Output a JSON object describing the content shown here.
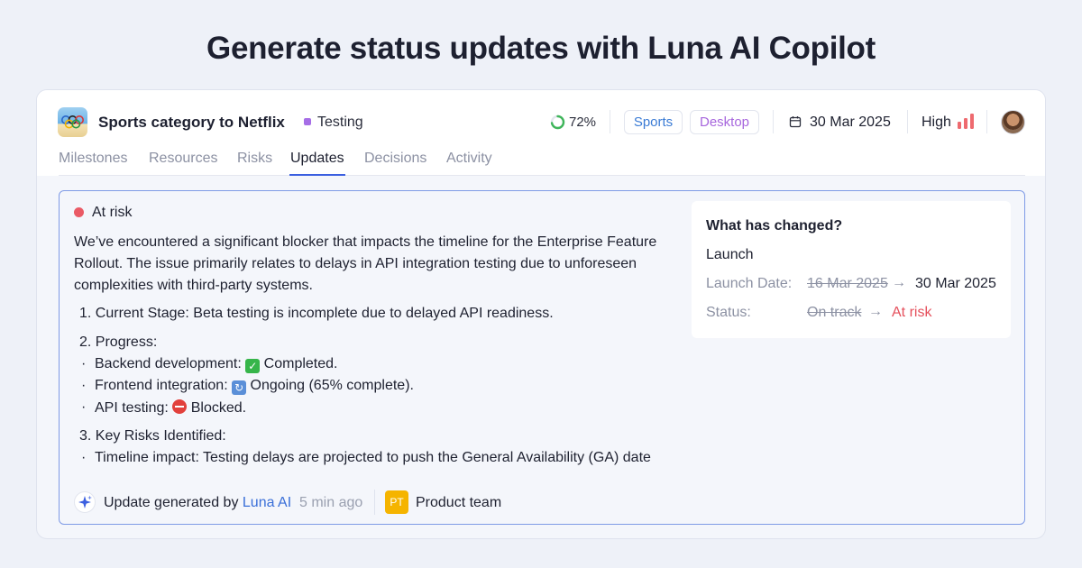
{
  "headline": "Generate status updates with Luna AI Copilot",
  "project": {
    "title": "Sports category to Netflix",
    "status": "Testing",
    "progress_text": "72%",
    "progress_fraction": 0.72,
    "tags": [
      "Sports",
      "Desktop"
    ],
    "date": "30 Mar 2025",
    "priority": "High",
    "icons": {
      "logo": "olympic-rings-logo",
      "progress": "progress-ring-icon",
      "calendar": "calendar-icon",
      "priority": "signal-bars-icon",
      "avatar": "user-avatar"
    }
  },
  "tabs": [
    {
      "label": "Milestones",
      "active": false
    },
    {
      "label": "Resources",
      "active": false
    },
    {
      "label": "Risks",
      "active": false
    },
    {
      "label": "Updates",
      "active": true
    },
    {
      "label": "Decisions",
      "active": false
    },
    {
      "label": "Activity",
      "active": false
    }
  ],
  "update": {
    "status": "At risk",
    "intro": "We’ve encountered a significant blocker that impacts the timeline for the Enterprise Feature Rollout. The issue primarily relates to delays in API integration testing due to unforeseen complexities with third-party systems.",
    "item1": "1. Current Stage: Beta testing is incomplete due to delayed API readiness.",
    "item2": "2. Progress:",
    "bullet_backend_a": "Backend development: ",
    "bullet_backend_b": " Completed.",
    "bullet_frontend_a": "Frontend integration: ",
    "bullet_frontend_b": " Ongoing (65% complete).",
    "bullet_api_a": "API testing: ",
    "bullet_api_b": " Blocked.",
    "item3": "3. Key Risks Identified:",
    "bullet_timeline": "Timeline impact: Testing delays are projected to push the General Availability (GA) date",
    "footer": {
      "prefix": "Update generated by ",
      "author": "Luna AI",
      "time": "5 min ago",
      "team_initials": "PT",
      "team": "Product team"
    }
  },
  "changes": {
    "title": "What has changed?",
    "milestone": "Launch",
    "launch_key": "Launch Date:",
    "launch_old": "16 Mar 2025",
    "launch_new": "30 Mar 2025",
    "status_key": "Status:",
    "status_old": "On track",
    "status_new": "At risk",
    "arrow": "→"
  },
  "colors": {
    "accent": "#3b5fe0",
    "risk": "#ea5a65",
    "testing": "#a66ee6",
    "sports_tag": "#3a7bd5",
    "desktop_tag": "#a766dd",
    "team_badge": "#f5b400"
  }
}
